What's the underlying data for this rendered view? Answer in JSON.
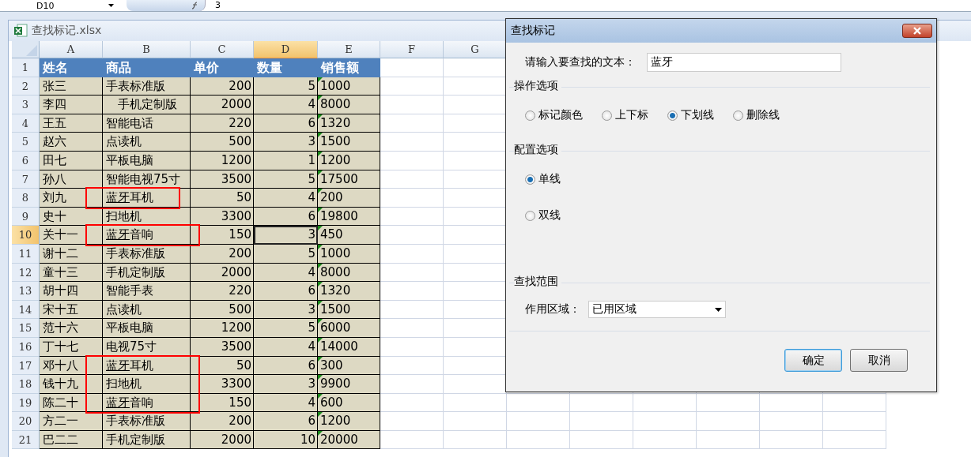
{
  "formula_bar": {
    "name_box": "D10",
    "formula": "3"
  },
  "workbook": {
    "title": "查找标记.xlsx"
  },
  "columns": [
    {
      "label": "A",
      "selected": false
    },
    {
      "label": "B",
      "selected": false
    },
    {
      "label": "C",
      "selected": false
    },
    {
      "label": "D",
      "selected": true
    },
    {
      "label": "E",
      "selected": false
    },
    {
      "label": "F",
      "selected": false
    },
    {
      "label": "G",
      "selected": false
    }
  ],
  "header_row": {
    "number": "1",
    "cells": [
      "姓名",
      "商品",
      "单价",
      "数量",
      "销售额"
    ]
  },
  "rows": [
    {
      "number": "2",
      "selected": false,
      "boxed": false,
      "name": "张三",
      "product": [
        {
          "text": "手表标准版",
          "underline": false
        }
      ],
      "price": "200",
      "qty": "5",
      "sales": "1000",
      "error_flag": true
    },
    {
      "number": "3",
      "selected": false,
      "boxed": false,
      "name": "李四",
      "product": [
        {
          "text": "　手机定制版",
          "underline": false
        }
      ],
      "price": "2000",
      "qty": "4",
      "sales": "8000",
      "error_flag": true
    },
    {
      "number": "4",
      "selected": false,
      "boxed": false,
      "name": "王五",
      "product": [
        {
          "text": "智能电话",
          "underline": false
        }
      ],
      "price": "220",
      "qty": "6",
      "sales": "1320",
      "error_flag": true
    },
    {
      "number": "5",
      "selected": false,
      "boxed": false,
      "name": "赵六",
      "product": [
        {
          "text": "点读机",
          "underline": false
        }
      ],
      "price": "500",
      "qty": "3",
      "sales": "1500",
      "error_flag": true
    },
    {
      "number": "6",
      "selected": false,
      "boxed": false,
      "name": "田七",
      "product": [
        {
          "text": "平板电脑",
          "underline": false
        }
      ],
      "price": "1200",
      "qty": "1",
      "sales": "1200",
      "error_flag": true
    },
    {
      "number": "7",
      "selected": false,
      "boxed": false,
      "name": "孙八",
      "product": [
        {
          "text": "智能电视75寸",
          "underline": false
        }
      ],
      "price": "3500",
      "qty": "5",
      "sales": "17500",
      "error_flag": true
    },
    {
      "number": "8",
      "selected": false,
      "boxed": true,
      "name": "刘九",
      "product": [
        {
          "text": "蓝牙",
          "underline": true
        },
        {
          "text": "耳机",
          "underline": false
        }
      ],
      "price": "50",
      "qty": "4",
      "sales": "200",
      "error_flag": true
    },
    {
      "number": "9",
      "selected": false,
      "boxed": false,
      "name": "史十",
      "product": [
        {
          "text": "扫地机",
          "underline": false
        }
      ],
      "price": "3300",
      "qty": "6",
      "sales": "19800",
      "error_flag": true
    },
    {
      "number": "10",
      "selected": true,
      "boxed": true,
      "name": "关十一",
      "product": [
        {
          "text": "蓝牙",
          "underline": true
        },
        {
          "text": "音响",
          "underline": false
        }
      ],
      "price": "150",
      "qty": "3",
      "sales": "450",
      "error_flag": true
    },
    {
      "number": "11",
      "selected": false,
      "boxed": false,
      "name": "谢十二",
      "product": [
        {
          "text": "手表标准版",
          "underline": false
        }
      ],
      "price": "200",
      "qty": "5",
      "sales": "1000",
      "error_flag": true
    },
    {
      "number": "12",
      "selected": false,
      "boxed": false,
      "name": "童十三",
      "product": [
        {
          "text": "手机定制版",
          "underline": false
        }
      ],
      "price": "2000",
      "qty": "4",
      "sales": "8000",
      "error_flag": true
    },
    {
      "number": "13",
      "selected": false,
      "boxed": false,
      "name": "胡十四",
      "product": [
        {
          "text": "智能手表",
          "underline": false
        }
      ],
      "price": "220",
      "qty": "6",
      "sales": "1320",
      "error_flag": true
    },
    {
      "number": "14",
      "selected": false,
      "boxed": false,
      "name": "宋十五",
      "product": [
        {
          "text": "点读机",
          "underline": false
        }
      ],
      "price": "500",
      "qty": "3",
      "sales": "1500",
      "error_flag": true
    },
    {
      "number": "15",
      "selected": false,
      "boxed": false,
      "name": "范十六",
      "product": [
        {
          "text": "平板电脑",
          "underline": false
        }
      ],
      "price": "1200",
      "qty": "5",
      "sales": "6000",
      "error_flag": true
    },
    {
      "number": "16",
      "selected": false,
      "boxed": false,
      "name": "丁十七",
      "product": [
        {
          "text": "电视75寸",
          "underline": false
        }
      ],
      "price": "3500",
      "qty": "4",
      "sales": "14000",
      "error_flag": true
    },
    {
      "number": "17",
      "selected": false,
      "boxed": true,
      "name": "邓十八",
      "product": [
        {
          "text": "蓝牙",
          "underline": true
        },
        {
          "text": "耳机",
          "underline": false
        }
      ],
      "price": "50",
      "qty": "6",
      "sales": "300",
      "error_flag": true
    },
    {
      "number": "18",
      "selected": false,
      "boxed": true,
      "name": "钱十九",
      "product": [
        {
          "text": "扫地机",
          "underline": false
        }
      ],
      "price": "3300",
      "qty": "3",
      "sales": "9900",
      "error_flag": true
    },
    {
      "number": "19",
      "selected": false,
      "boxed": true,
      "name": "陈二十",
      "product": [
        {
          "text": "蓝牙",
          "underline": true
        },
        {
          "text": "音响",
          "underline": false
        }
      ],
      "price": "150",
      "qty": "4",
      "sales": "600",
      "error_flag": true
    },
    {
      "number": "20",
      "selected": false,
      "boxed": false,
      "name": "方二一",
      "product": [
        {
          "text": "手表标准版",
          "underline": false
        }
      ],
      "price": "200",
      "qty": "6",
      "sales": "1200",
      "error_flag": true
    },
    {
      "number": "21",
      "selected": false,
      "boxed": false,
      "name": "巴二二",
      "product": [
        {
          "text": "手机定制版",
          "underline": false
        }
      ],
      "price": "2000",
      "qty": "10",
      "sales": "20000",
      "error_flag": true
    }
  ],
  "dialog": {
    "title": "查找标记",
    "search_label": "请输入要查找的文本：",
    "search_value": "蓝牙",
    "operation_group": {
      "title": "操作选项",
      "options": [
        {
          "label": "标记颜色",
          "selected": false
        },
        {
          "label": "上下标",
          "selected": false
        },
        {
          "label": "下划线",
          "selected": true
        },
        {
          "label": "删除线",
          "selected": false
        }
      ]
    },
    "config_group": {
      "title": "配置选项",
      "options": [
        {
          "label": "单线",
          "selected": true
        },
        {
          "label": "双线",
          "selected": false
        }
      ]
    },
    "scope_group": {
      "title": "查找范围",
      "label": "作用区域：",
      "value": "已用区域"
    },
    "buttons": [
      {
        "label": "确定",
        "default": true
      },
      {
        "label": "取消",
        "default": false
      }
    ]
  }
}
